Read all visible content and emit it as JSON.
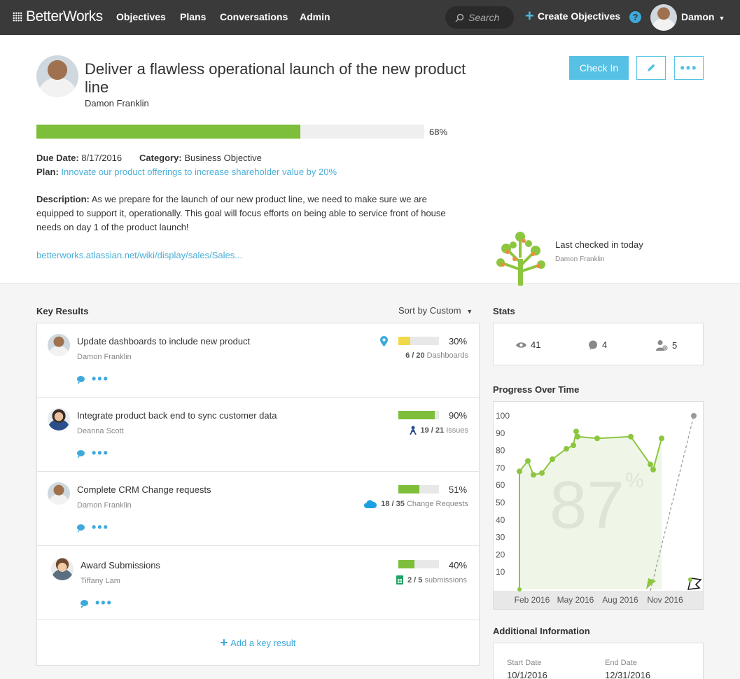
{
  "nav": {
    "logo": "BetterWorks",
    "items": [
      "Objectives",
      "Plans",
      "Conversations",
      "Admin"
    ],
    "search_placeholder": "Search",
    "create_label": "Create Objectives",
    "help": "?",
    "user": "Damon"
  },
  "objective": {
    "title": "Deliver a flawless operational launch of the new product line",
    "owner": "Damon Franklin",
    "progress": 68,
    "progress_label": "68%",
    "checkin_label": "Check In",
    "due_label": "Due Date:",
    "due_date": "8/17/2016",
    "category_label": "Category:",
    "category": "Business Objective",
    "plan_label": "Plan:",
    "plan": "Innovate our product offerings to increase shareholder value by 20%",
    "description_label": "Description:",
    "description": "As we prepare for the launch of our new product line, we need to make sure we are equipped to support it, operationally. This goal will focus efforts on being able to service front of house needs on day 1 of the product launch!",
    "link": "betterworks.atlassian.net/wiki/display/sales/Sales...",
    "last_checked": "Last checked in today",
    "last_checked_by": "Damon Franklin"
  },
  "key_results": {
    "heading": "Key Results",
    "sort_label": "Sort by Custom",
    "add_label": "Add a key result",
    "items": [
      {
        "title": "Update dashboards to include new product",
        "owner": "Damon Franklin",
        "pct": "30%",
        "progress": 30,
        "color": "#f0d84a",
        "metric_count": "6 / 20",
        "metric_unit": "Dashboards",
        "icon": "map-pin-icon"
      },
      {
        "title": "Integrate product back end to sync customer data",
        "owner": "Deanna Scott",
        "pct": "90%",
        "progress": 90,
        "color": "#7dbf3b",
        "metric_count": "19 / 21",
        "metric_unit": "Issues",
        "icon": "jira-icon"
      },
      {
        "title": "Complete CRM Change requests",
        "owner": "Damon Franklin",
        "pct": "51%",
        "progress": 51,
        "color": "#7dbf3b",
        "metric_count": "18 / 35",
        "metric_unit": "Change Requests",
        "icon": "salesforce-cloud-icon"
      },
      {
        "title": "Award Submissions",
        "owner": "Tiffany Lam",
        "pct": "40%",
        "progress": 40,
        "color": "#7dbf3b",
        "metric_count": "2 / 5",
        "metric_unit": "submissions",
        "icon": "sheets-icon"
      }
    ]
  },
  "stats": {
    "heading": "Stats",
    "views": "41",
    "comments": "4",
    "followers": "5"
  },
  "chart_data": {
    "type": "line",
    "title": "Progress Over Time",
    "watermark": "87",
    "watermark_unit": "%",
    "ylim": [
      0,
      100
    ],
    "yticks": [
      "100",
      "90",
      "80",
      "70",
      "60",
      "50",
      "40",
      "30",
      "20",
      "10"
    ],
    "xticks": [
      "Feb 2016",
      "May 2016",
      "Aug 2016",
      "Nov 2016"
    ],
    "series": [
      {
        "values": [
          0,
          68,
          74,
          66,
          67,
          75,
          81,
          83,
          91,
          88,
          87,
          88,
          72,
          69,
          87
        ]
      },
      {
        "values": [
          0,
          100
        ]
      }
    ]
  },
  "additional": {
    "heading": "Additional Information",
    "start_label": "Start Date",
    "start_date": "10/1/2016",
    "end_label": "End Date",
    "end_date": "12/31/2016"
  }
}
